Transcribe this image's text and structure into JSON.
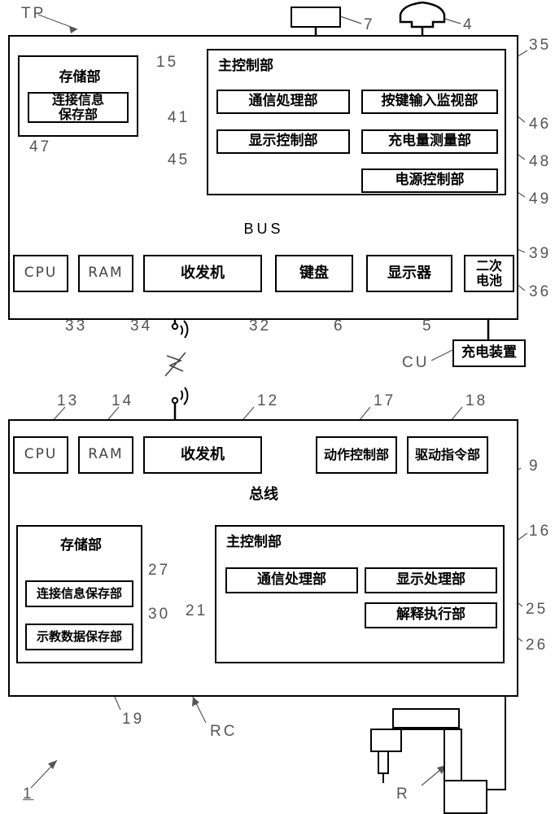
{
  "figure": {
    "type": "patent-block-diagram",
    "overall_ref": "1"
  },
  "teach_pendant": {
    "code": "TP",
    "panel_ref": "35",
    "external": {
      "display_unit": {
        "ref": "7",
        "shape": "rectangle"
      },
      "emergency_stop": {
        "ref": "4",
        "shape": "mushroom-button"
      }
    },
    "storage": {
      "title": "存储部",
      "ref": "15",
      "children": [
        {
          "label": "连接信息\n保存部",
          "ref": "47"
        }
      ]
    },
    "main_control": {
      "title": "主控制部",
      "ref": "35",
      "blocks": [
        {
          "label": "通信処理部",
          "ref": "41"
        },
        {
          "label": "按键输入监视部",
          "ref": "46"
        },
        {
          "label": "显示控制部",
          "ref": "45"
        },
        {
          "label": "充电量测量部",
          "ref": "48"
        },
        {
          "label": "电源控制部",
          "ref": "49"
        }
      ]
    },
    "bus": {
      "label": "BUS",
      "ref": "39"
    },
    "devices": [
      {
        "label": "CPU",
        "ref": "33"
      },
      {
        "label": "RAM",
        "ref": "34"
      },
      {
        "label": "收发机",
        "ref": "32"
      },
      {
        "label": "键盘",
        "ref": "6"
      },
      {
        "label": "显示器",
        "ref": "5"
      },
      {
        "label": "二次\n电池",
        "ref": "36"
      }
    ],
    "charger": {
      "label": "充电装置",
      "code": "CU"
    }
  },
  "robot_controller": {
    "code": "RC",
    "panel_ref": "16",
    "devices": [
      {
        "label": "CPU",
        "ref": "13"
      },
      {
        "label": "RAM",
        "ref": "14"
      },
      {
        "label": "收发机",
        "ref": "12"
      },
      {
        "label": "动作控制部",
        "ref": "17"
      },
      {
        "label": "驱动指令部",
        "ref": "18"
      }
    ],
    "bus": {
      "label": "总线",
      "ref": "9"
    },
    "storage": {
      "title": "存储部",
      "ref": "19",
      "children": [
        {
          "label": "连接信息保存部",
          "ref": "27"
        },
        {
          "label": "示教数据保存部",
          "ref": "30"
        }
      ]
    },
    "main_control": {
      "title": "主控制部",
      "ref": "16",
      "blocks": [
        {
          "label": "通信处理部",
          "ref": "21"
        },
        {
          "label": "显示处理部",
          "ref": "25"
        },
        {
          "label": "解释执行部",
          "ref": "26"
        }
      ]
    }
  },
  "robot": {
    "code": "R"
  },
  "wireless_link": {
    "upper_antenna": "antenna-icon",
    "lower_antenna": "antenna-icon",
    "bolt": "lightning-bolt-icon"
  },
  "colors": {
    "ink": "#000000",
    "ref_text": "#555555",
    "paper": "#ffffff"
  }
}
